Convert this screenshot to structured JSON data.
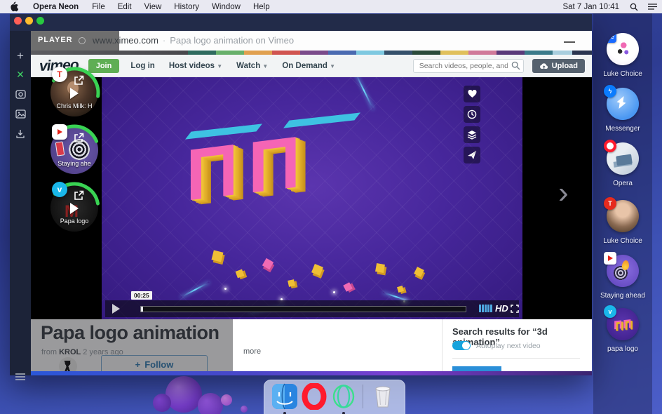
{
  "menu_bar": {
    "app_name": "Opera Neon",
    "items": [
      "File",
      "Edit",
      "View",
      "History",
      "Window",
      "Help"
    ],
    "datetime": "Sat 7 Jan 10:41"
  },
  "titlebar": {
    "player_badge": "PLAYER",
    "url": "www.ximeo.com",
    "separator": "·",
    "page_title": "Papa logo animation on Vimeo"
  },
  "vimeo_nav": {
    "logo": "vimeo",
    "join_label": "Join",
    "links": [
      "Log in",
      "Host videos",
      "Watch",
      "On Demand"
    ],
    "search_placeholder": "Search videos, people, and more",
    "upload_label": "Upload"
  },
  "bubbles": [
    {
      "label": "Chris Milk: H",
      "badge": "ted",
      "badge_letter": "T"
    },
    {
      "label": "Staying ahe",
      "badge": "youtube"
    },
    {
      "label": "Papa logo",
      "badge": "vimeo",
      "badge_letter": "v"
    }
  ],
  "video_player": {
    "time_tooltip": "00:25",
    "hd_label": "HD",
    "video_letters": "ПП"
  },
  "content": {
    "title": "Papa logo animation",
    "byline_from": "from ",
    "author": "KROL",
    "age": " 2 years ago",
    "more_label": "more",
    "follow_label": "Follow"
  },
  "results_panel": {
    "title": "Search results for “3d animation”",
    "autoplay_label": "Autoplay next video"
  },
  "speed_dial": [
    {
      "label": "Luke Choice",
      "badge": "behance"
    },
    {
      "label": "Messenger",
      "badge": "messenger"
    },
    {
      "label": "Opera",
      "badge": "opera"
    },
    {
      "label": "Luke Choice",
      "badge": "ted"
    },
    {
      "label": "Staying ahead",
      "badge": "youtube"
    },
    {
      "label": "papa logo",
      "badge": "vimeo"
    }
  ],
  "badges": {
    "behance": "Bē",
    "ted": "T",
    "vimeo": "v"
  },
  "dock": {
    "items": [
      "Finder",
      "Opera",
      "Opera Neon",
      "Trash"
    ]
  },
  "colors": {
    "accent_green": "#39d353",
    "vimeo_blue": "#1ab7ea",
    "ted_red": "#e62b1e",
    "opera_red": "#ff1b2d",
    "messenger_blue": "#0a7cff",
    "behance_blue": "#1769ff",
    "join_green": "#5fae54",
    "video_purple": "#47279c"
  }
}
